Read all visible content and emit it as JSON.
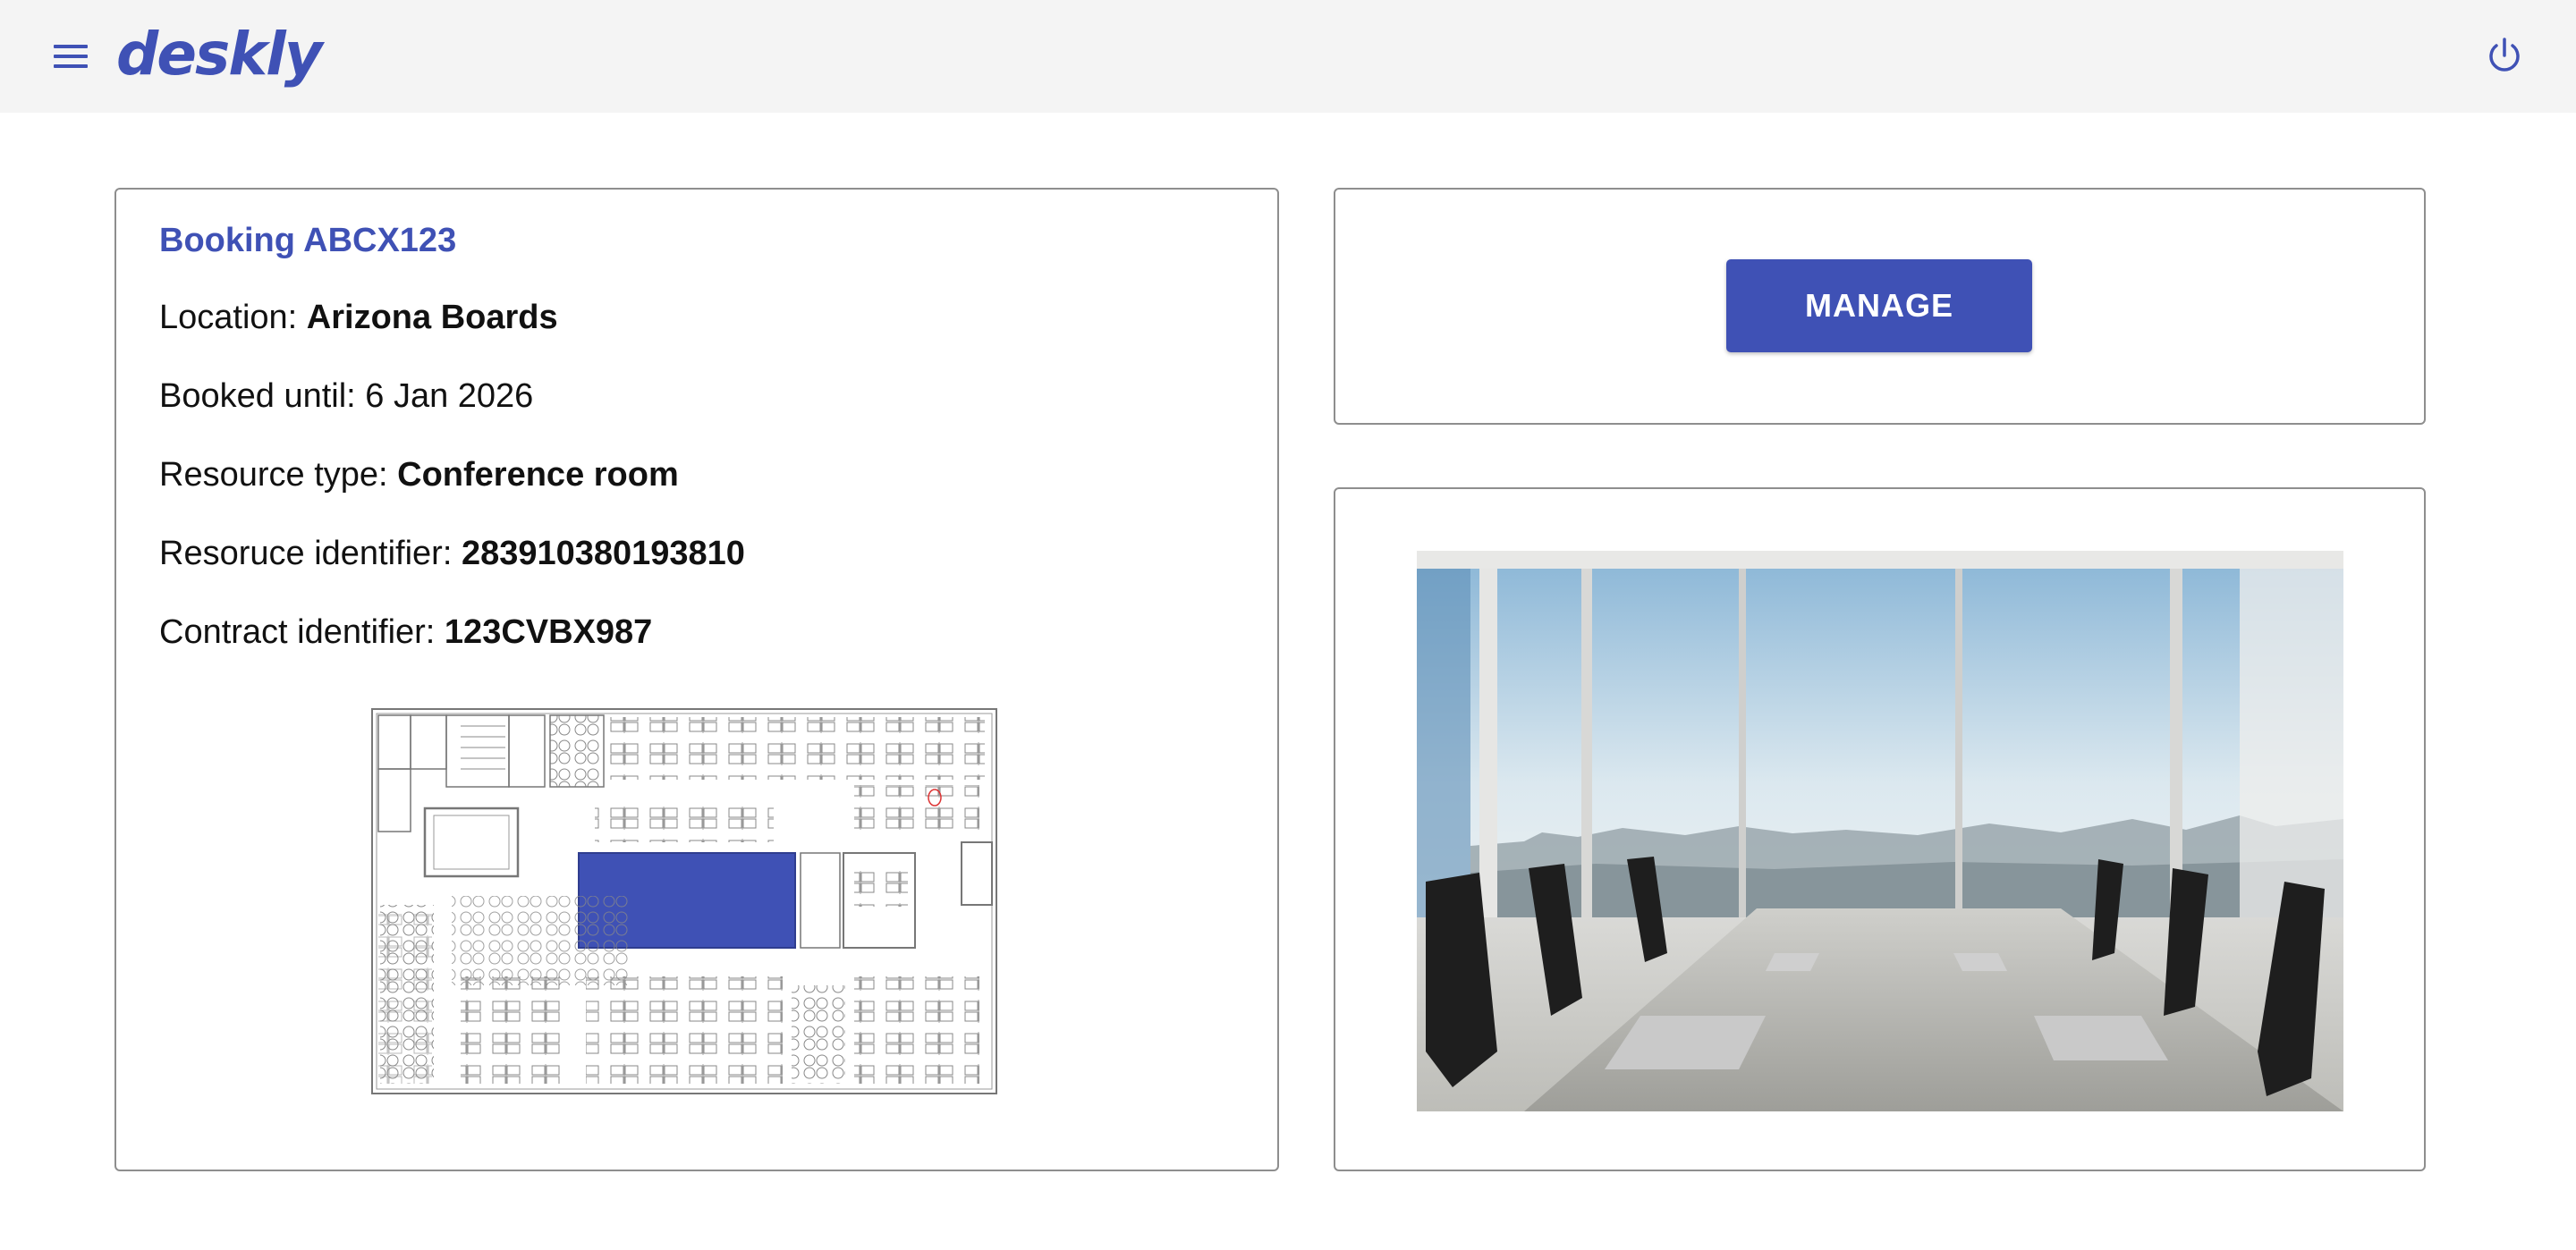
{
  "app": {
    "name": "deskly"
  },
  "header": {
    "menu_icon": "menu-icon",
    "power_icon": "power-icon"
  },
  "booking": {
    "title": "Booking ABCX123",
    "location_label": "Location: ",
    "location_value": "Arizona Boards",
    "booked_until_label": "Booked until: ",
    "booked_until_value": "6 Jan 2026",
    "resource_type_label": "Resource type: ",
    "resource_type_value": "Conference room",
    "resource_id_label": "Resoruce identifier: ",
    "resource_id_value": "283910380193810",
    "contract_id_label": "Contract identifier: ",
    "contract_id_value": "123CVBX987"
  },
  "actions": {
    "manage_label": "MANAGE"
  },
  "colors": {
    "accent": "#3f51b5",
    "header_bg": "#f4f4f4",
    "card_border": "#8e8e8e",
    "highlight_room": "#3f51b5"
  }
}
